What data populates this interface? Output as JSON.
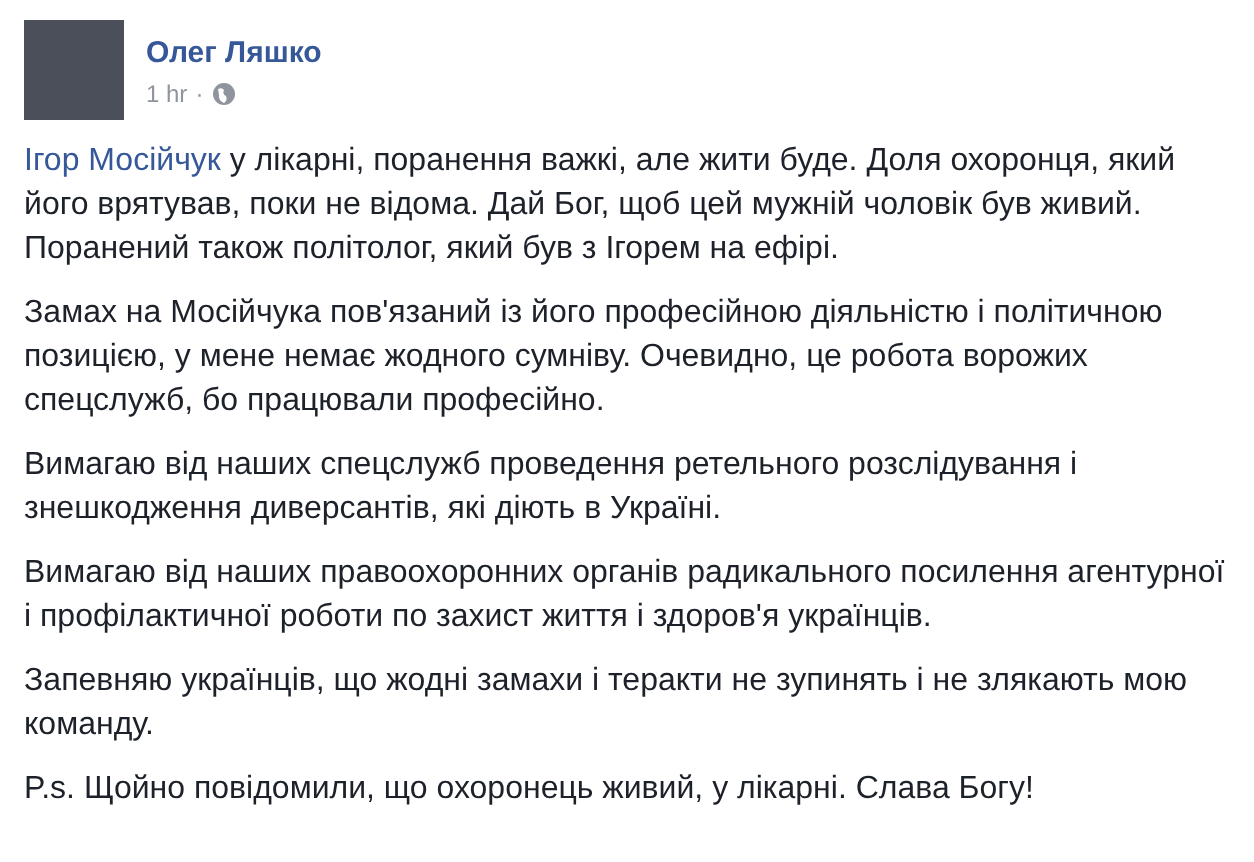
{
  "author": {
    "name": "Олег Ляшко",
    "time": "1 hr",
    "separator": "·"
  },
  "paragraphs": [
    {
      "mention": "Ігор Мосійчук",
      "text": " у лікарні, поранення важкі, але жити буде. Доля охоронця, який його врятував, поки не відома. Дай Бог, щоб цей мужній чоловік був живий. Поранений також політолог, який був з Ігорем на ефірі."
    },
    {
      "text": "Замах на Мосійчука пов'язаний із його професійною діяльністю і політичною позицією, у мене немає жодного сумніву. Очевидно, це робота ворожих спецслужб, бо працювали професійно."
    },
    {
      "text": "Вимагаю від наших спецслужб проведення ретельного розслідування і знешкодження диверсантів, які діють в Україні."
    },
    {
      "text": "Вимагаю від наших правоохоронних органів радикального посилення агентурної і профілактичної роботи по захист життя і здоров'я українців."
    },
    {
      "text": "Запевняю українців, що жодні замахи і теракти не зупинять і не злякають мою команду."
    },
    {
      "text": "P.s. Щойно повідомили, що охоронець живий, у лікарні. Слава Богу!"
    }
  ]
}
